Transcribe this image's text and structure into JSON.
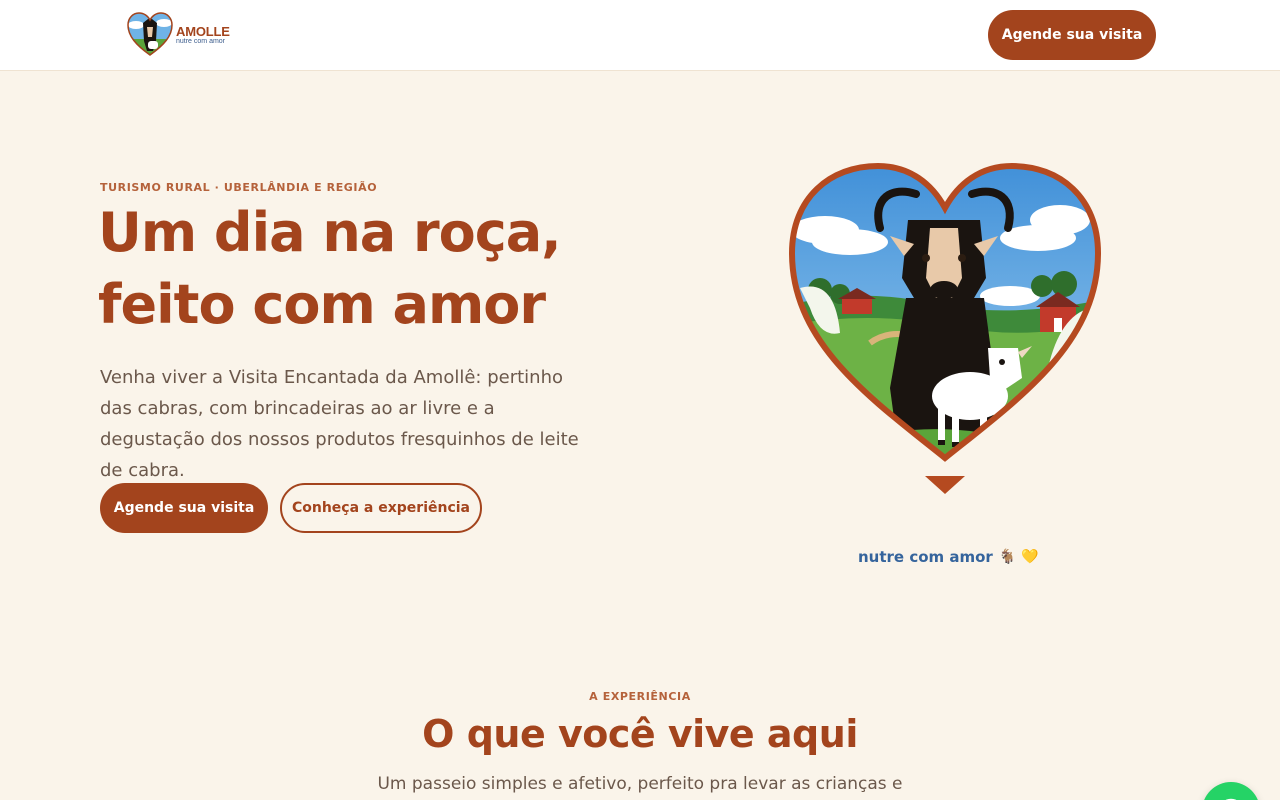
{
  "header": {
    "logo": {
      "name": "AMOLLE",
      "tagline": "nutre com amor"
    },
    "cta_label": "Agende sua visita"
  },
  "hero": {
    "eyebrow": "TURISMO RURAL · UBERLÂNDIA E REGIÃO",
    "title_line1": "Um dia na roça,",
    "title_line2": "feito com amor",
    "text": "Venha viver a Visita Encantada da Amollê: pertinho das cabras, com brincadeiras ao ar livre e a degustação dos nossos produtos fresquinhos de leite de cabra.",
    "primary_cta": "Agende sua visita",
    "secondary_cta": "Conheça a experiência",
    "art_tagline": "nutre com amor",
    "art_emojis": "🐐 💛"
  },
  "experience": {
    "eyebrow": "A EXPERIÊNCIA",
    "title": "O que você vive aqui",
    "text": "Um passeio simples e afetivo, perfeito pra levar as crianças e"
  },
  "floating": {
    "whatsapp_icon": "whatsapp-icon"
  },
  "colors": {
    "brand": "#a3441d",
    "background": "#faf4ea",
    "accent_blue": "#35649c",
    "whatsapp": "#25d366"
  }
}
